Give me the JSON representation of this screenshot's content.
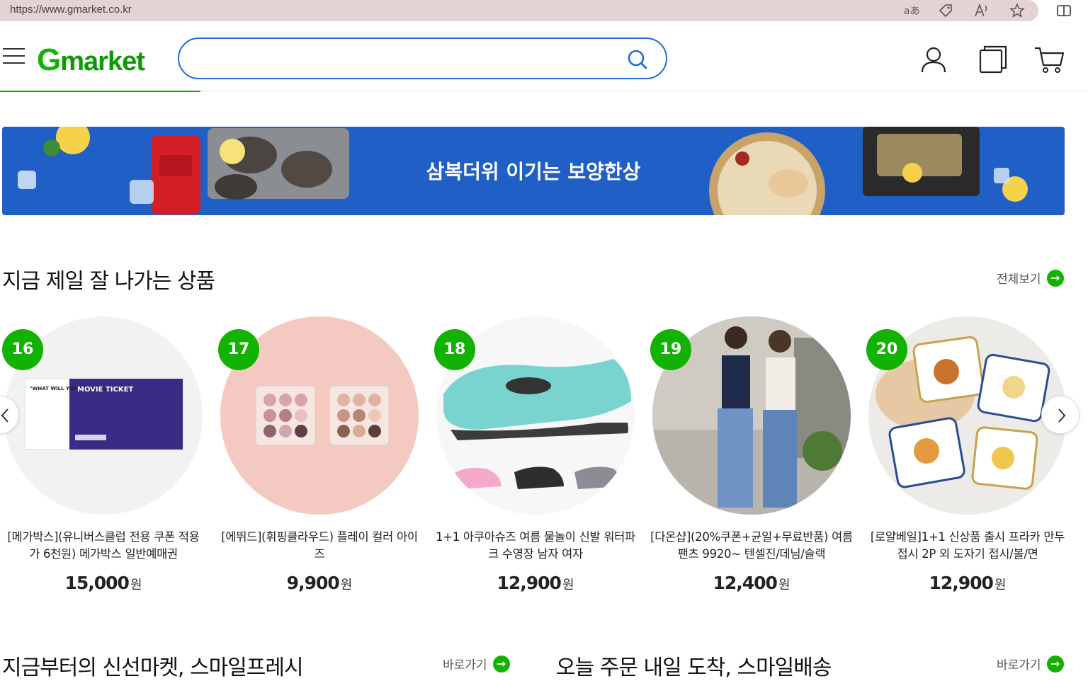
{
  "browser": {
    "url": "https://www.gmarket.co.kr"
  },
  "header": {
    "logo_g": "G",
    "logo_rest": "market",
    "search_placeholder": ""
  },
  "banner": {
    "text": "삼복더위 이기는 보양한상"
  },
  "bestsellers": {
    "title": "지금 제일 잘 나가는 상품",
    "more_label": "전체보기",
    "products": [
      {
        "rank": "16",
        "name": "[메가박스](유니버스클럽 전용 쿠폰 적용가 6천원) 메가박스 일반예매권",
        "price": "15,000",
        "unit": "원",
        "ticket_label": "MOVIE TICKET",
        "ticket_quote": "\"WHAT WILL YOUR VERSE BE?\""
      },
      {
        "rank": "17",
        "name": "[에뛰드](휘핑클라우드) 플레이 컬러 아이즈",
        "price": "9,900",
        "unit": "원"
      },
      {
        "rank": "18",
        "name": "1+1 아쿠아슈즈 여름 물놀이 신발 워터파크 수영장 남자 여자",
        "price": "12,900",
        "unit": "원"
      },
      {
        "rank": "19",
        "name": "[다온샵](20%쿠폰+균일+무료반품) 여름팬츠 9920~ 텐셀진/데님/슬랙",
        "price": "12,400",
        "unit": "원"
      },
      {
        "rank": "20",
        "name": "[로얄베일]1+1 신상품 출시 프라카 만두접시 2P 외 도자기 접시/볼/면",
        "price": "12,900",
        "unit": "원"
      }
    ]
  },
  "fresh": {
    "title": "지금부터의 신선마켓, 스마일프레시",
    "more_label": "바로가기"
  },
  "delivery": {
    "title": "오늘 주문 내일 도착, 스마일배송",
    "more_label": "바로가기"
  },
  "colors": {
    "brand_green": "#12b300",
    "search_blue": "#1e6bdc",
    "banner_blue": "#1f5fc6"
  }
}
